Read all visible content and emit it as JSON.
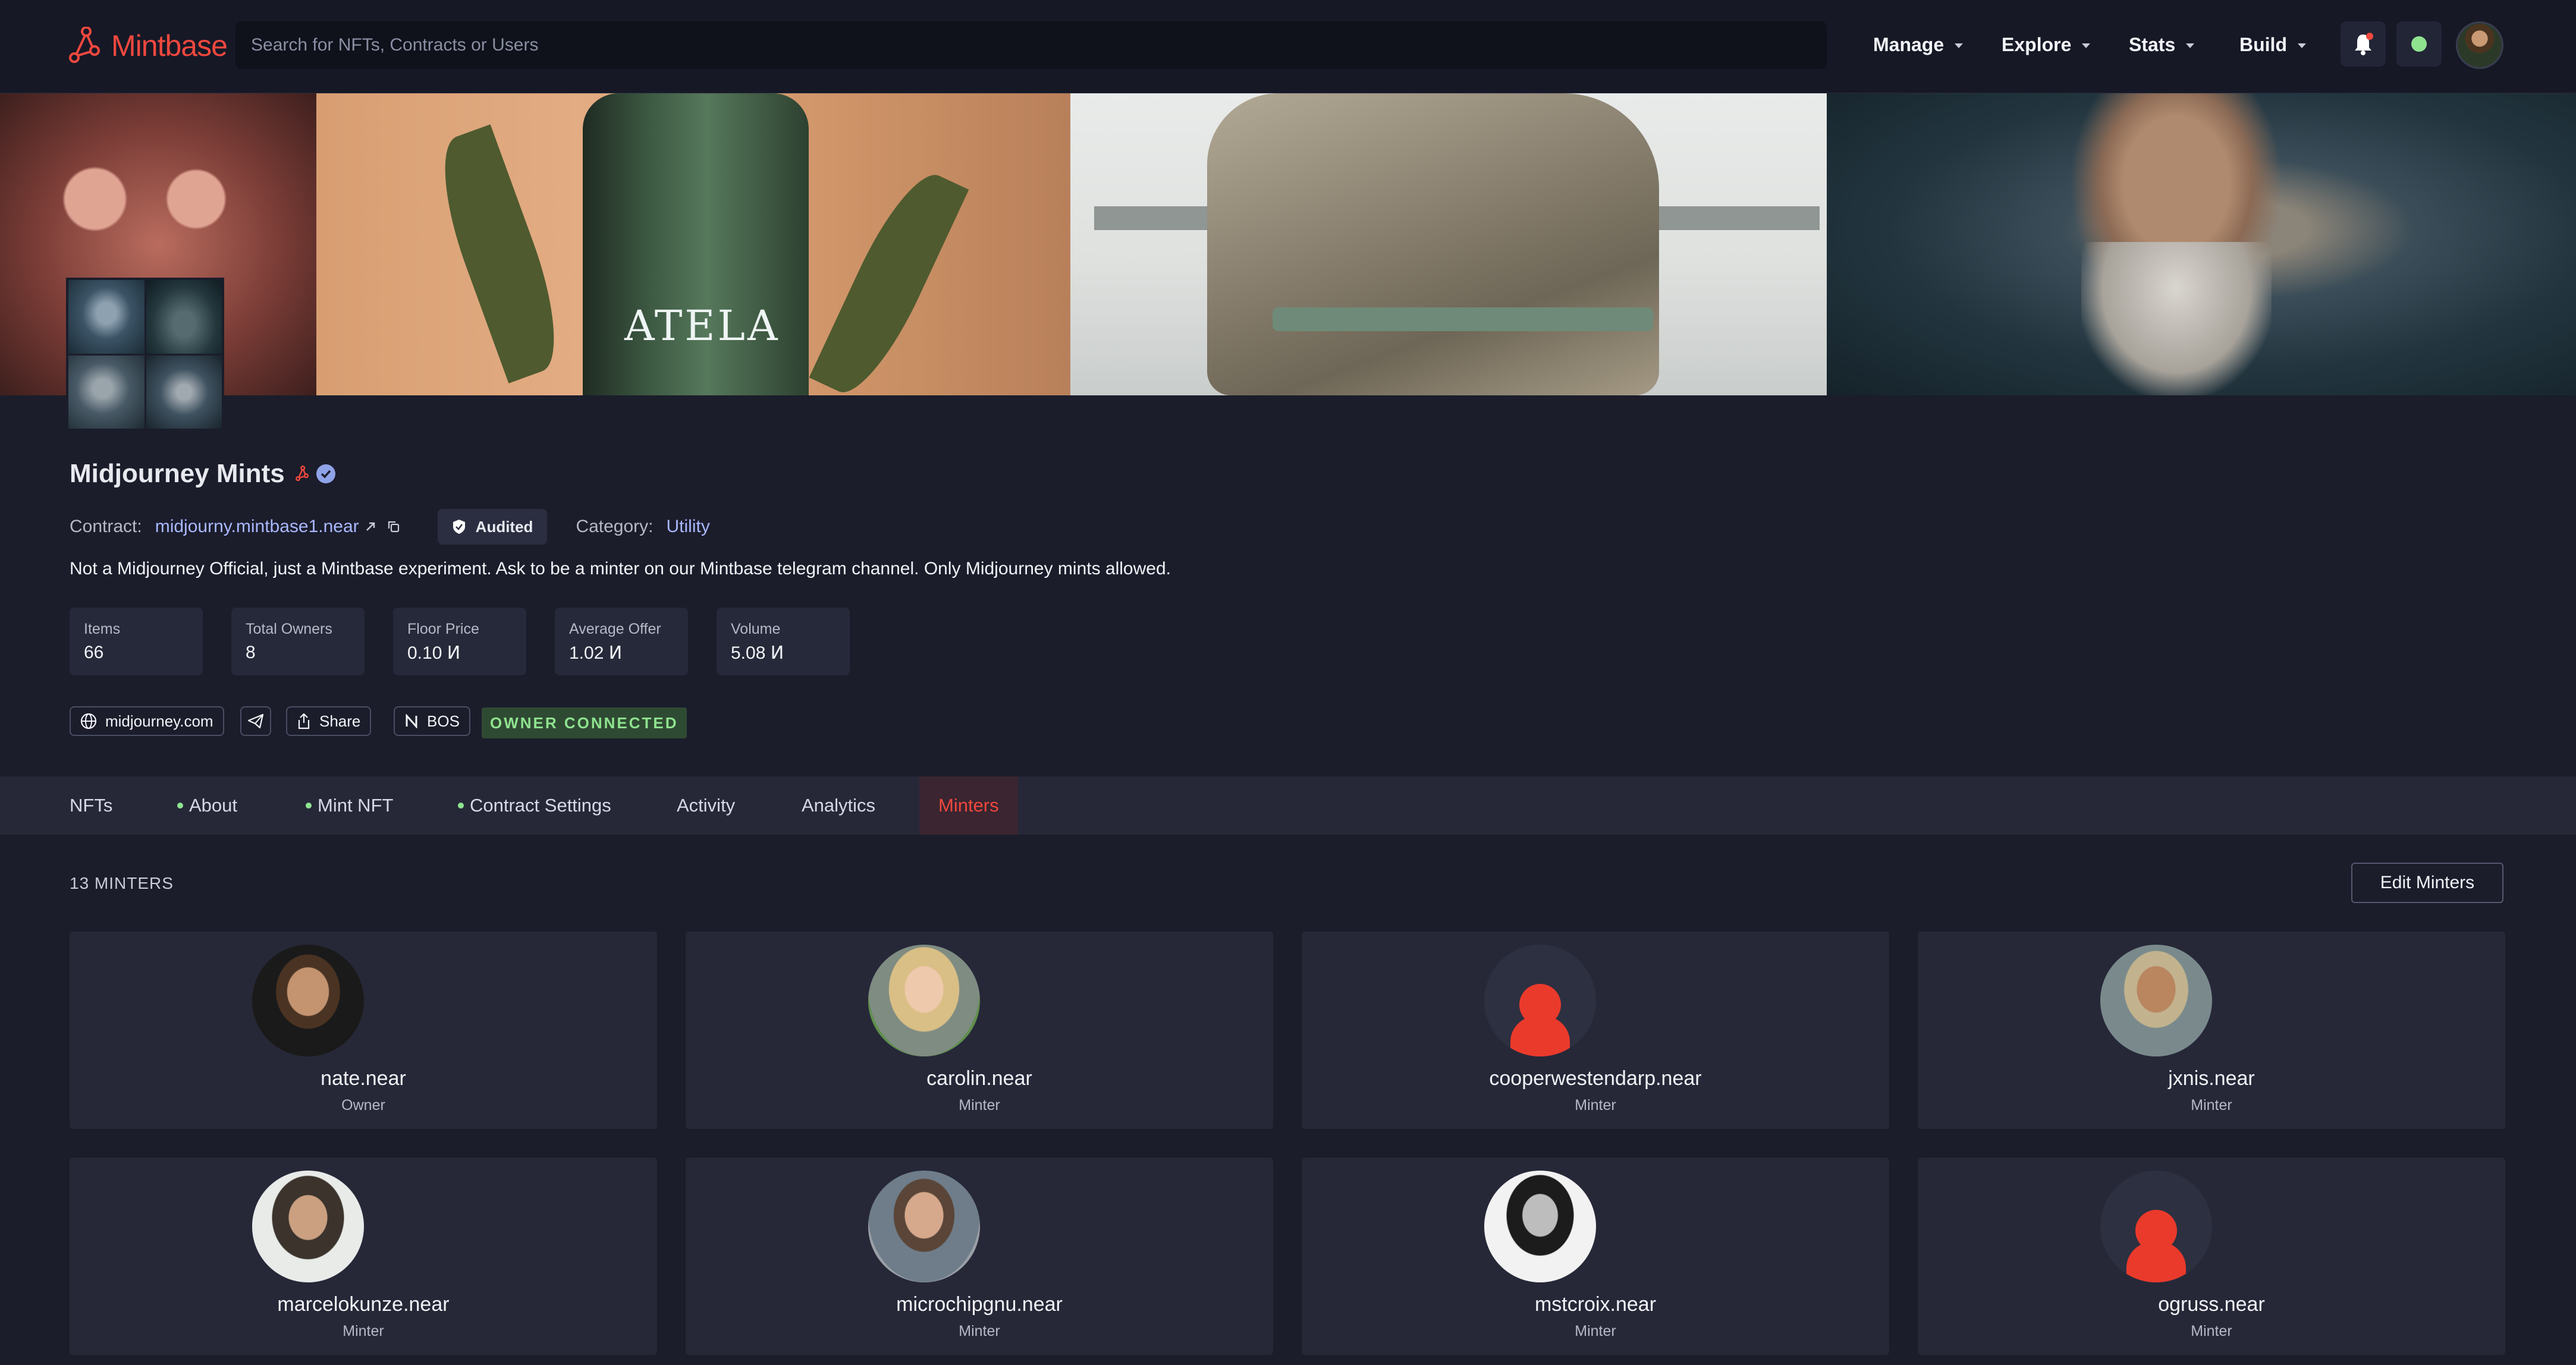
{
  "nav": {
    "brand": "Mintbase",
    "search_placeholder": "Search for NFTs, Contracts or Users",
    "menu": [
      "Manage",
      "Explore",
      "Stats",
      "Build"
    ]
  },
  "collection": {
    "title": "Midjourney Mints",
    "contract_label": "Contract:",
    "contract_value": "midjourny.mintbase1.near",
    "audited_label": "Audited",
    "category_label": "Category:",
    "category_value": "Utility",
    "description": "Not a Midjourney Official, just a Mintbase experiment. Ask to be a minter on our Mintbase telegram channel. Only Midjourney mints allowed.",
    "banner_text": "ATELA"
  },
  "stats": [
    {
      "label": "Items",
      "value": "66"
    },
    {
      "label": "Total Owners",
      "value": "8"
    },
    {
      "label": "Floor Price",
      "value": "0.10 Ͷ"
    },
    {
      "label": "Average Offer",
      "value": "1.02 Ͷ"
    },
    {
      "label": "Volume",
      "value": "5.08 Ͷ"
    }
  ],
  "links": {
    "website": "midjourney.com",
    "share": "Share",
    "bos": "BOS",
    "owner_badge": "OWNER CONNECTED"
  },
  "tabs": [
    "NFTs",
    "About",
    "Mint NFT",
    "Contract Settings",
    "Activity",
    "Analytics",
    "Minters"
  ],
  "minters": {
    "count_label": "13 MINTERS",
    "edit_label": "Edit Minters",
    "items": [
      {
        "name": "nate.near",
        "role": "Owner"
      },
      {
        "name": "carolin.near",
        "role": "Minter"
      },
      {
        "name": "cooperwestendarp.near",
        "role": "Minter"
      },
      {
        "name": "jxnis.near",
        "role": "Minter"
      },
      {
        "name": "marcelokunze.near",
        "role": "Minter"
      },
      {
        "name": "microchipgnu.near",
        "role": "Minter"
      },
      {
        "name": "mstcroix.near",
        "role": "Minter"
      },
      {
        "name": "ogruss.near",
        "role": "Minter"
      }
    ]
  },
  "colors": {
    "brand": "#f0483e",
    "background": "#1b1d2b",
    "link": "#a9b8ff",
    "owner_badge": "#8fe38f"
  },
  "icons": [
    "mintbase-logo-icon",
    "bell-icon",
    "status-dot-icon",
    "verified-icon",
    "external-link-icon",
    "copy-icon",
    "shield-icon",
    "globe-icon",
    "telegram-icon",
    "share-icon",
    "near-icon"
  ]
}
